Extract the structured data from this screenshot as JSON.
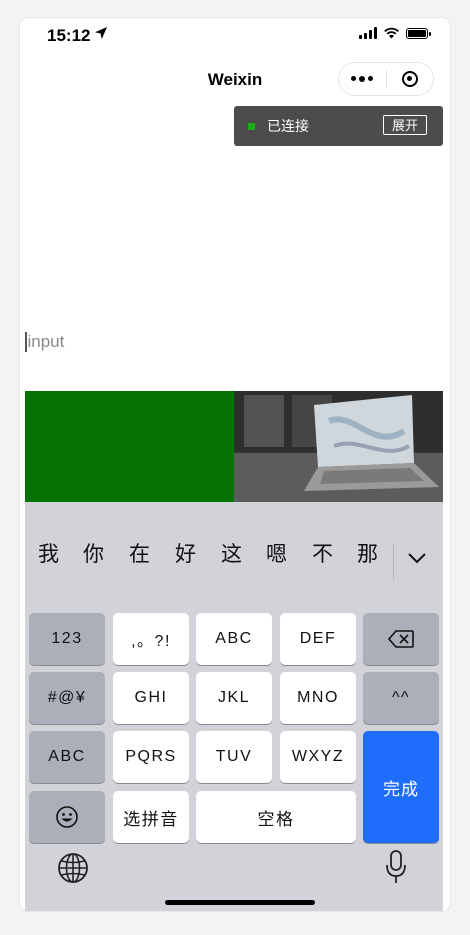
{
  "status": {
    "time": "15:12"
  },
  "nav": {
    "title": "Weixin"
  },
  "banner": {
    "status": "已连接",
    "expand_label": "展开"
  },
  "input": {
    "placeholder": "input"
  },
  "keyboard": {
    "candidates": [
      "我",
      "你",
      "在",
      "好",
      "这",
      "嗯",
      "不",
      "那"
    ],
    "rows": [
      [
        "123",
        ",。?!",
        "ABC",
        "DEF"
      ],
      [
        "#@¥",
        "GHI",
        "JKL",
        "MNO",
        "^^"
      ],
      [
        "ABC",
        "PQRS",
        "TUV",
        "WXYZ"
      ],
      [
        "选拼音",
        "空格"
      ]
    ],
    "done_label": "完成"
  },
  "colors": {
    "accent": "#1f6dfb",
    "green_block": "#047304",
    "banner_dot": "#1aad19"
  },
  "icons": [
    "location-arrow-icon",
    "signal-icon",
    "wifi-icon",
    "battery-icon",
    "more-dots-icon",
    "close-target-icon",
    "backspace-icon",
    "emoji-icon",
    "globe-icon",
    "microphone-icon",
    "chevron-down-icon"
  ]
}
